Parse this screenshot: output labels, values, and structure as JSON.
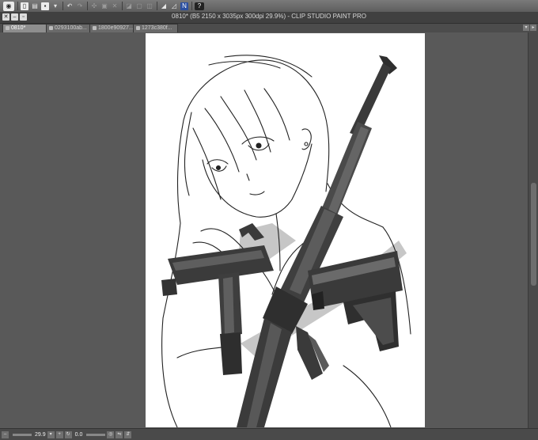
{
  "window": {
    "title": "0810* (B5 2150 x 3035px 300dpi 29.9%)  - CLIP STUDIO PAINT PRO"
  },
  "command_bar": {
    "icons": [
      "clip-studio-logo-icon",
      "new-icon",
      "open-icon",
      "save-icon",
      "undo-icon",
      "redo-icon",
      "clear-icon",
      "transform-icon",
      "cut-icon",
      "fill-icon",
      "select-icon",
      "blue-icon",
      "help-icon"
    ]
  },
  "tabs": [
    {
      "label": "0810*",
      "active": true
    },
    {
      "label": "0293100ab...",
      "active": false
    },
    {
      "label": "1800e90927...",
      "active": false
    },
    {
      "label": "1273c380f...",
      "active": false
    }
  ],
  "status": {
    "zoom": "29.9",
    "angle": "0.0"
  },
  "colors": {
    "workspace": "#595959",
    "paper": "#ffffff",
    "toolbar": "#6a6a6a"
  }
}
